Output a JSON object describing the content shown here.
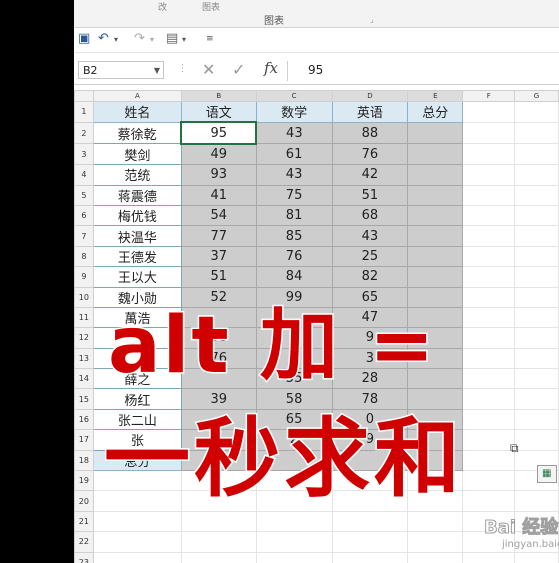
{
  "ribbon": {
    "ghost_left": "改",
    "ghost_mid": "图表",
    "group_label": "图表"
  },
  "qat": {
    "save_icon": "save-icon",
    "undo_icon": "undo-icon",
    "redo_icon": "redo-icon"
  },
  "formula_bar": {
    "name_box": "B2",
    "value": "95",
    "fx": "fx"
  },
  "columns": [
    "A",
    "B",
    "C",
    "D",
    "E",
    "F",
    "G"
  ],
  "rows": [
    "1",
    "2",
    "3",
    "4",
    "5",
    "6",
    "7",
    "8",
    "9",
    "10",
    "11",
    "12",
    "13",
    "14",
    "15",
    "16",
    "17",
    "18",
    "19",
    "20",
    "21",
    "22",
    "23"
  ],
  "headers": [
    "姓名",
    "语文",
    "数学",
    "英语",
    "总分"
  ],
  "students": [
    {
      "name": "蔡徐乾",
      "chinese": "95",
      "math": "43",
      "english": "88"
    },
    {
      "name": "樊剑",
      "chinese": "49",
      "math": "61",
      "english": "76"
    },
    {
      "name": "范统",
      "chinese": "93",
      "math": "43",
      "english": "42"
    },
    {
      "name": "蒋震德",
      "chinese": "41",
      "math": "75",
      "english": "51"
    },
    {
      "name": "梅优钱",
      "chinese": "54",
      "math": "81",
      "english": "68"
    },
    {
      "name": "袂温华",
      "chinese": "77",
      "math": "85",
      "english": "43"
    },
    {
      "name": "王德发",
      "chinese": "37",
      "math": "76",
      "english": "25"
    },
    {
      "name": "王以大",
      "chinese": "51",
      "math": "84",
      "english": "82"
    },
    {
      "name": "魏小勋",
      "chinese": "52",
      "math": "99",
      "english": "65"
    },
    {
      "name": "萬浩",
      "chinese": "",
      "math": "",
      "english": "47"
    },
    {
      "name": "",
      "chinese": "68",
      "math": "",
      "english": "9"
    },
    {
      "name": "",
      "chinese": "76",
      "math": "",
      "english": "3"
    },
    {
      "name": "薛之",
      "chinese": "",
      "math": "55",
      "english": "28"
    },
    {
      "name": "杨红",
      "chinese": "39",
      "math": "58",
      "english": "78"
    },
    {
      "name": "张二山",
      "chinese": "",
      "math": "65",
      "english": "0"
    },
    {
      "name": "张",
      "chinese": "",
      "math": "2",
      "english": "9"
    }
  ],
  "total_label": "总分",
  "overlay": {
    "line1": "alt 加 =",
    "line2": "一秒求和"
  },
  "watermark": {
    "brand": "Bai 经验",
    "sub": "jingyan.baidu.com"
  }
}
